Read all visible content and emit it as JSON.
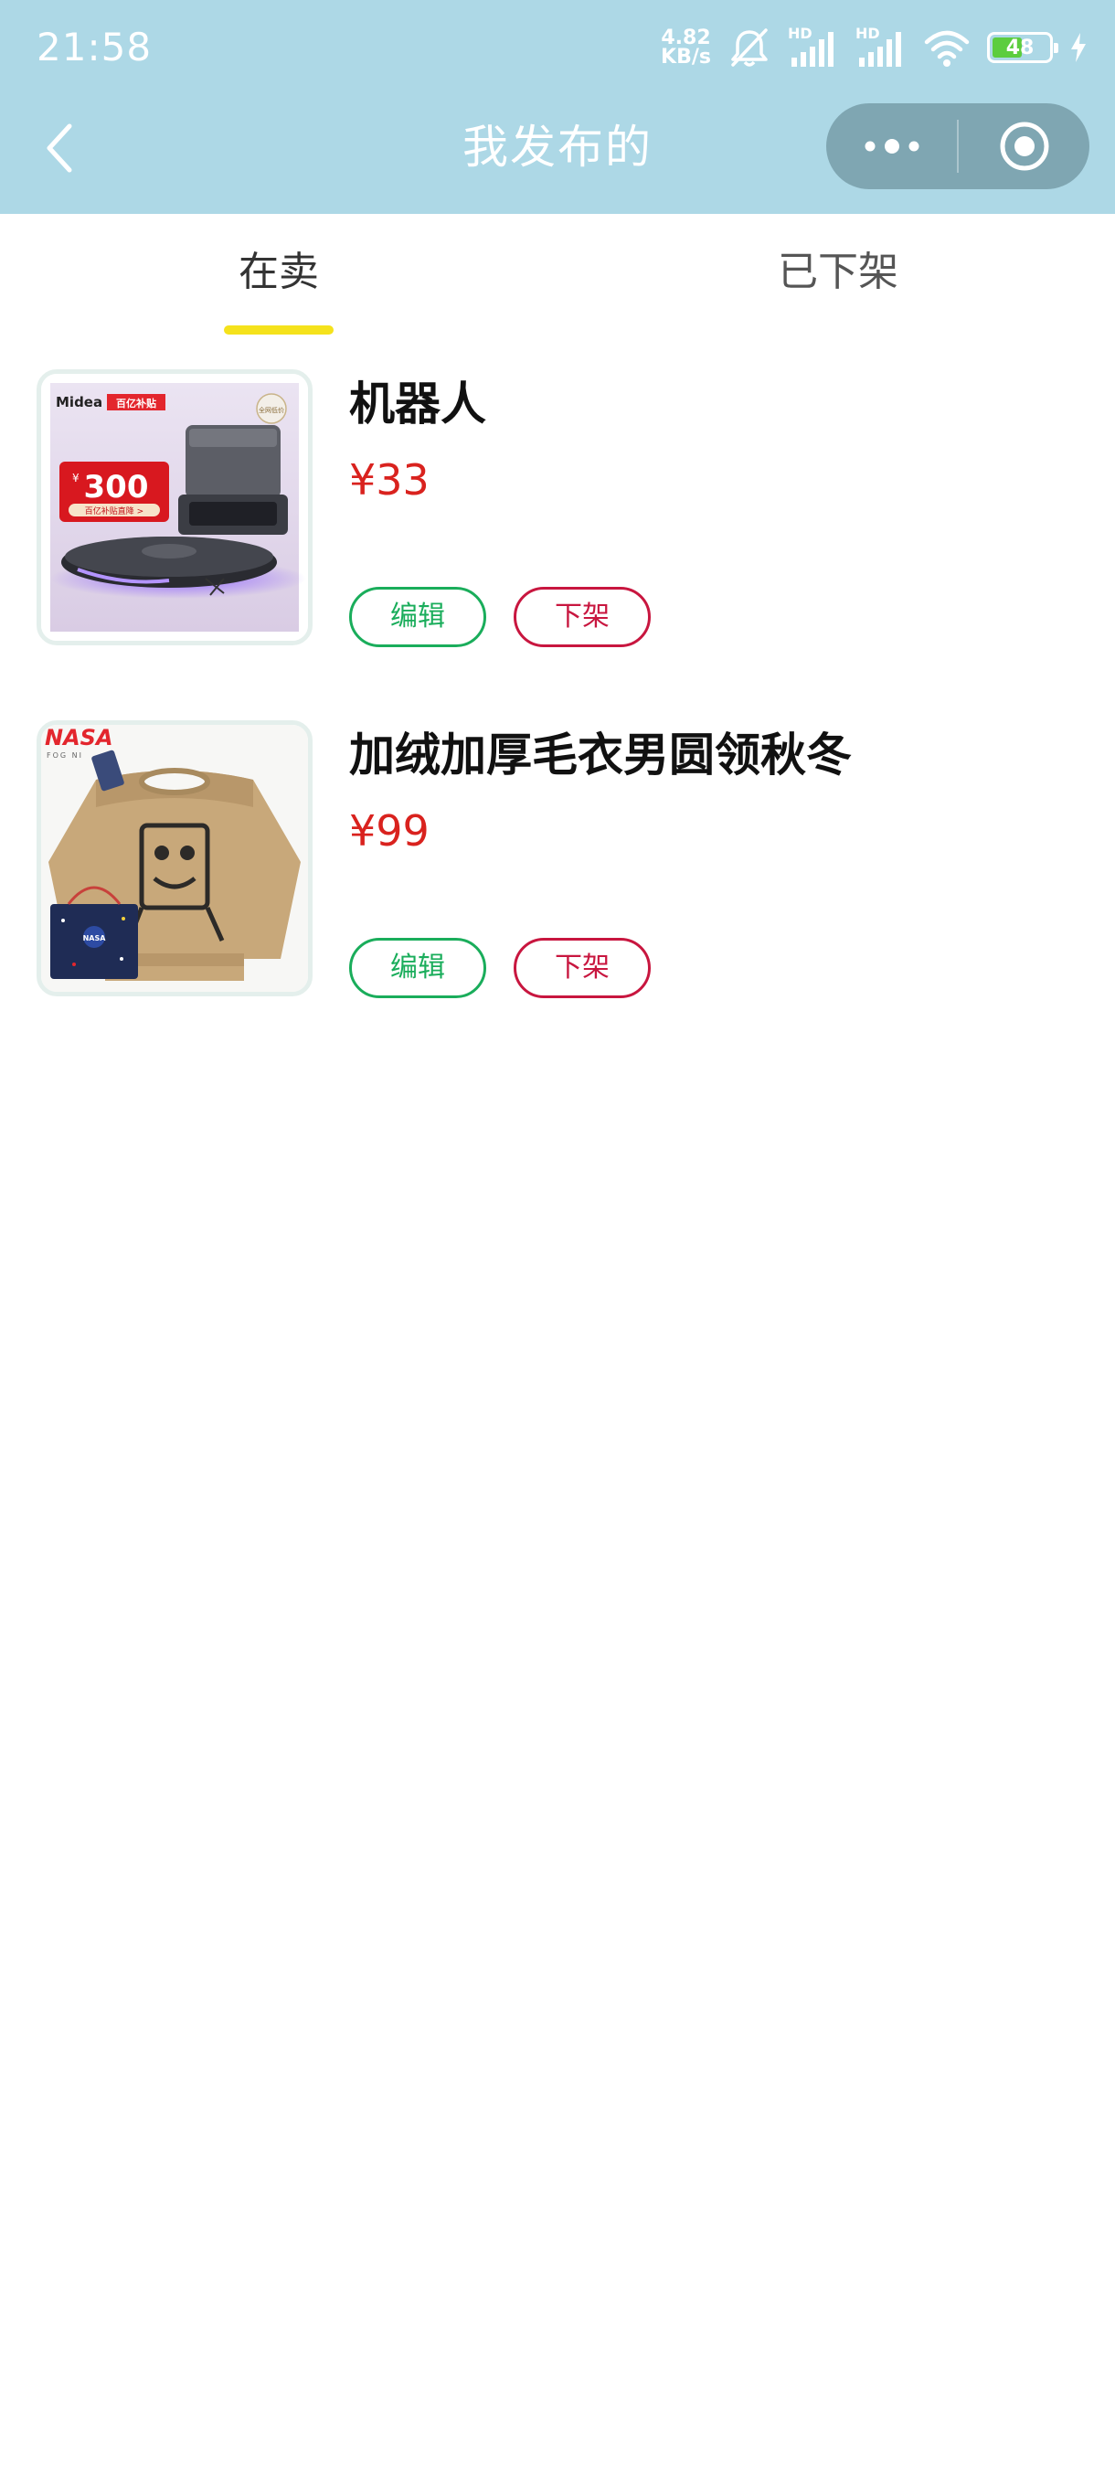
{
  "status_bar": {
    "time": "21:58",
    "net_speed_value": "4.82",
    "net_speed_unit": "KB/s",
    "hd_label": "HD",
    "battery_level": "48",
    "battery_fraction": 0.48
  },
  "nav": {
    "title": "我发布的"
  },
  "tabs": [
    {
      "label": "在卖",
      "active": true
    },
    {
      "label": "已下架",
      "active": false
    }
  ],
  "products": [
    {
      "title": "机器人",
      "price": "¥33",
      "edit_label": "编辑",
      "delist_label": "下架",
      "image": {
        "brand_text": "Midea",
        "promo_text": "百亿补贴",
        "amount_text": "300",
        "currency_text": "¥",
        "sub_text": "百亿补贴直降 >",
        "badge_text": "全网低价"
      }
    },
    {
      "title": "加绒加厚毛衣男圆领秋冬",
      "price": "¥99",
      "edit_label": "编辑",
      "delist_label": "下架",
      "image": {
        "brand_text": "NASA",
        "sub_text": "FOG NI",
        "bag_text": "NASA"
      }
    }
  ],
  "colors": {
    "header_bg": "#add8e6",
    "tab_indicator": "#f5e21c",
    "price": "#d9221e",
    "edit_button": "#1aad5b",
    "delist_button": "#c8163f"
  }
}
